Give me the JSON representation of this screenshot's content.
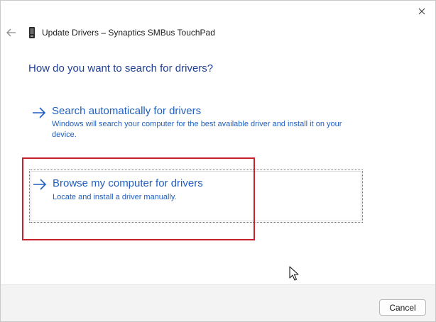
{
  "window": {
    "title": "Update Drivers – Synaptics SMBus TouchPad",
    "icons": {
      "close": "close-icon",
      "back": "back-arrow-icon",
      "device": "device-driver-icon"
    }
  },
  "main": {
    "question": "How do you want to search for drivers?",
    "options": [
      {
        "title": "Search automatically for drivers",
        "description": "Windows will search your computer for the best available driver and install it on your device.",
        "icon": "arrow-right-icon"
      },
      {
        "title": "Browse my computer for drivers",
        "description": "Locate and install a driver manually.",
        "icon": "arrow-right-icon"
      }
    ]
  },
  "footer": {
    "cancel_label": "Cancel"
  },
  "colors": {
    "link_blue": "#1f5fbf",
    "heading_blue": "#1f3f94",
    "highlight_red": "#c8202e",
    "footer_bg": "#f3f3f3"
  }
}
